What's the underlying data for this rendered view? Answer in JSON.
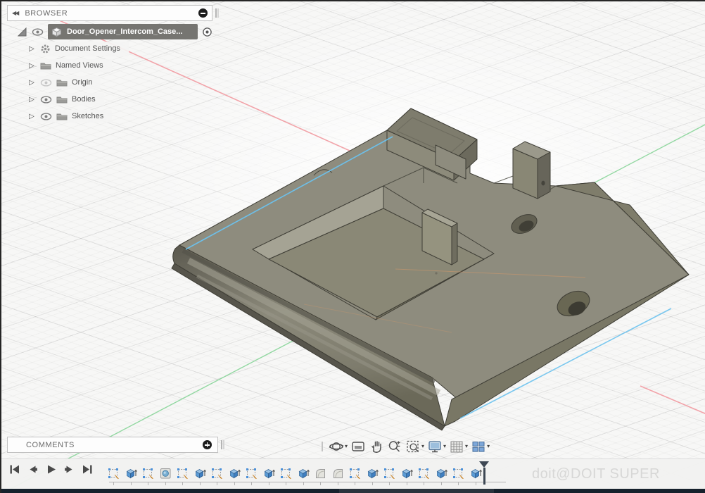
{
  "window": {
    "watermark": "doit@DOIT SUPER"
  },
  "browser": {
    "title": "BROWSER",
    "root": {
      "label": "Door_Opener_Intercom_Case...",
      "selected": true
    },
    "items": [
      {
        "label": "Document Settings",
        "icon": "gear-icon",
        "eye": "none"
      },
      {
        "label": "Named Views",
        "icon": "folder-icon",
        "eye": "none"
      },
      {
        "label": "Origin",
        "icon": "folder-icon",
        "eye": "hidden"
      },
      {
        "label": "Bodies",
        "icon": "folder-icon",
        "eye": "visible"
      },
      {
        "label": "Sketches",
        "icon": "folder-icon",
        "eye": "visible"
      }
    ]
  },
  "comments": {
    "title": "COMMENTS"
  },
  "nav_toolbar": {
    "items": [
      {
        "name": "orbit",
        "caret": true
      },
      {
        "name": "look-at",
        "caret": false
      },
      {
        "name": "pan",
        "caret": false
      },
      {
        "name": "zoom",
        "caret": false
      },
      {
        "name": "fit",
        "caret": true
      },
      {
        "name": "display-settings",
        "caret": true
      },
      {
        "name": "grid-display",
        "caret": true
      },
      {
        "name": "viewports",
        "caret": true
      }
    ]
  },
  "timeline": {
    "playback": [
      "go-to-start",
      "step-back",
      "play",
      "step-forward",
      "go-to-end"
    ],
    "features": [
      "sketch",
      "extrude",
      "sketch",
      "hole",
      "sketch",
      "extrude",
      "sketch",
      "extrude",
      "sketch",
      "extrude",
      "sketch",
      "extrude",
      "fillet",
      "fillet",
      "sketch",
      "extrude",
      "sketch",
      "extrude",
      "sketch",
      "extrude",
      "sketch",
      "extrude"
    ],
    "marker": "position-marker"
  },
  "canvas": {
    "model_name": "Door_Opener_Intercom_Case",
    "model_color": "#8e8c7e",
    "axis_x_color": "#f2a3a9",
    "axis_y_color": "#93d8a2",
    "sketch_highlight_color": "#6cc2ee",
    "background": "#f7f7f6"
  }
}
